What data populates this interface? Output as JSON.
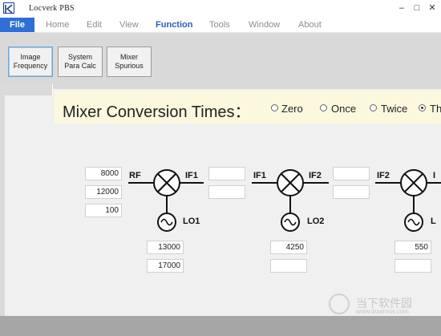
{
  "window": {
    "title": "Locverk PBS",
    "minimize": "–",
    "maximize": "□",
    "close": "✕"
  },
  "menu": {
    "file": "File",
    "items": [
      "Home",
      "Edit",
      "View",
      "Function",
      "Tools",
      "Window",
      "About"
    ],
    "active": "Function"
  },
  "toolbar": {
    "buttons": [
      {
        "line1": "Image",
        "line2": "Frequency"
      },
      {
        "line1": "System",
        "line2": "Para Calc"
      },
      {
        "line1": "Mixer",
        "line2": "Spurious"
      }
    ]
  },
  "mixer": {
    "title": "Mixer Conversion Times：",
    "options": [
      "Zero",
      "Once",
      "Twice",
      "Th"
    ],
    "selected": "Th",
    "stage1": {
      "in_label": "RF",
      "out_label": "IF1",
      "lo_label": "LO1",
      "in_values": [
        "8000",
        "12000",
        "100"
      ],
      "out_values": [
        "",
        ""
      ],
      "lo_values": [
        "13000",
        "17000"
      ]
    },
    "stage2": {
      "in_label": "IF1",
      "out_label": "IF2",
      "lo_label": "LO2",
      "out_values": [
        "",
        ""
      ],
      "lo_values": [
        "4250",
        ""
      ]
    },
    "stage3": {
      "in_label": "IF2",
      "out_label": "I",
      "lo_label": "L",
      "lo_values": [
        "550",
        ""
      ]
    }
  },
  "watermark": {
    "text": "当下软件园",
    "url": "www.downxia.com"
  },
  "colors": {
    "accent": "#2f6fd6",
    "banner": "#fbf8de",
    "panel": "#f0f0f0"
  }
}
